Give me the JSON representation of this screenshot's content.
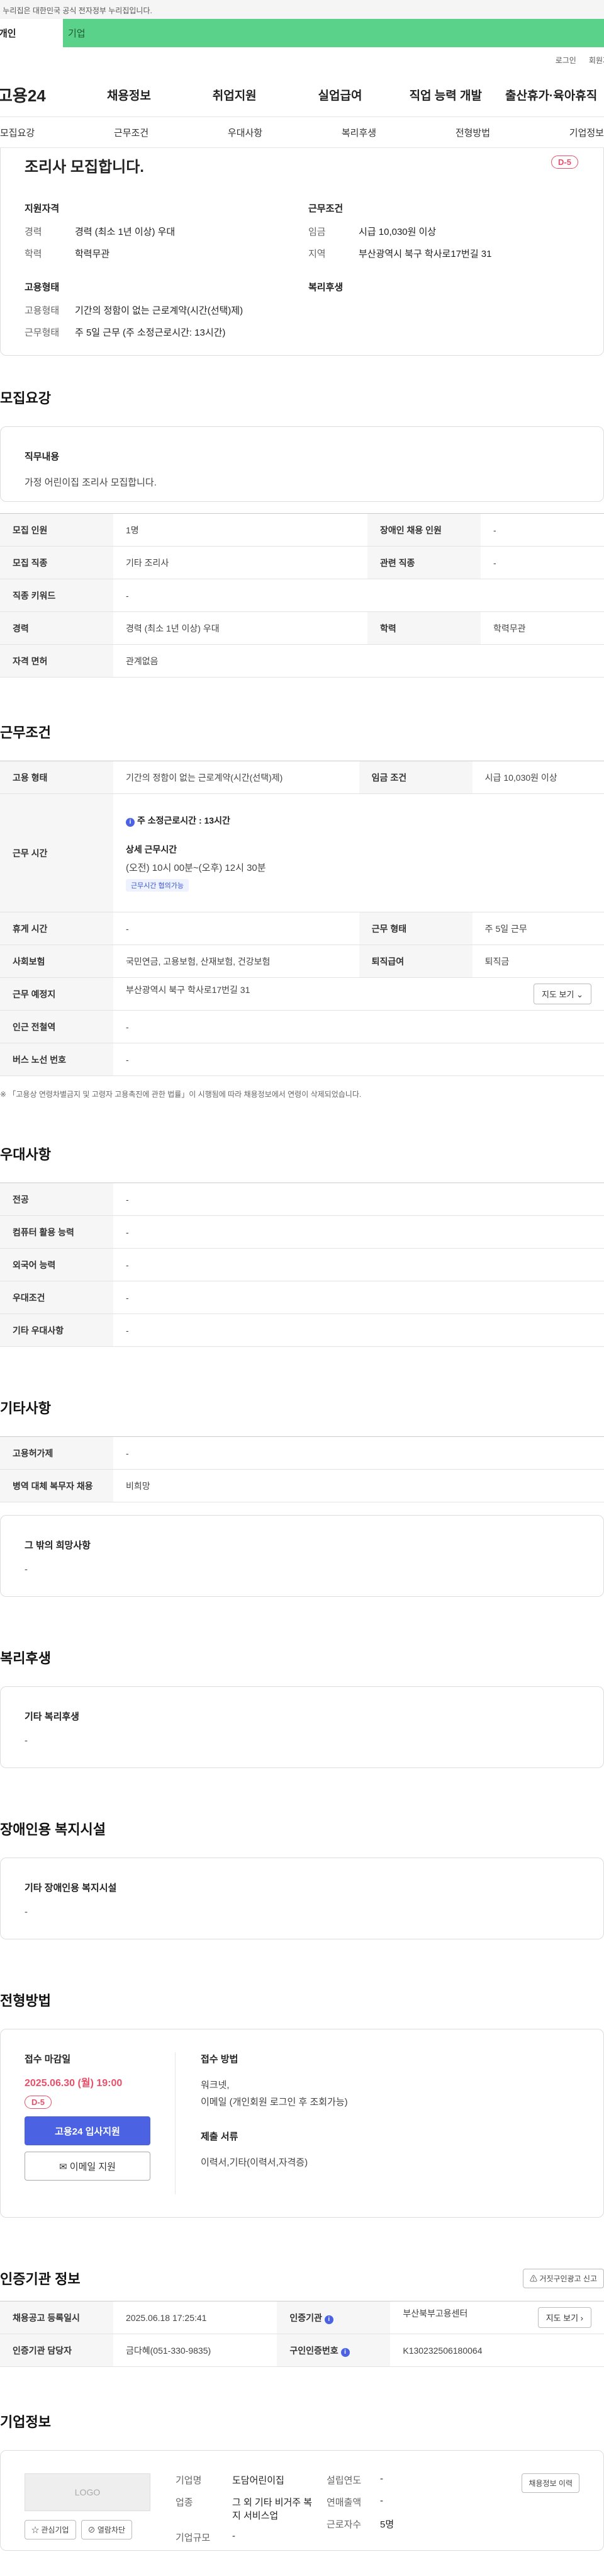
{
  "gov_notice": "이 누리집은 대한민국 공식 전자정부 누리집입니다.",
  "tabs": {
    "personal": "개인",
    "company": "기업"
  },
  "util": {
    "login": "로그인",
    "join": "회원가입"
  },
  "logo": "고용24",
  "mainnav": [
    "채용정보",
    "취업지원",
    "실업급여",
    "직업 능력 개발",
    "출산휴가·육아휴직"
  ],
  "subnav": [
    "모집요강",
    "근무조건",
    "우대사항",
    "복리후생",
    "전형방법",
    "기업정보"
  ],
  "summary": {
    "title": "조리사 모집합니다.",
    "dday": "D-5",
    "qual_title": "지원자격",
    "qual": [
      {
        "k": "경력",
        "v": "경력 (최소 1년 이상) 우대"
      },
      {
        "k": "학력",
        "v": "학력무관"
      }
    ],
    "work_title": "근무조건",
    "work": [
      {
        "k": "임금",
        "v": "시급 10,030원 이상"
      },
      {
        "k": "지역",
        "v": "부산광역시 북구 학사로17번길 31"
      }
    ],
    "emp_title": "고용형태",
    "emp": [
      {
        "k": "고용형태",
        "v": "기간의 정함이 없는 근로계약(시간(선택)제)"
      },
      {
        "k": "근무형태",
        "v": "주 5일 근무 (주 소정근로시간: 13시간)"
      }
    ],
    "welfare_title": "복리후생"
  },
  "recruit": {
    "heading": "모집요강",
    "duty_title": "직무내용",
    "duty_body": "가정 어린이집 조리사 모집합니다.",
    "rows": [
      {
        "k1": "모집 인원",
        "v1": "1명",
        "k2": "장애인 채용 인원",
        "v2": "-"
      },
      {
        "k1": "모집 직종",
        "v1": "기타 조리사",
        "k2": "관련 직종",
        "v2": "-"
      },
      {
        "k1": "직종 키워드",
        "v1": "-"
      },
      {
        "k1": "경력",
        "v1": "경력 (최소 1년 이상) 우대",
        "k2": "학력",
        "v2": "학력무관"
      },
      {
        "k1": "자격 면허",
        "v1": "관계없음"
      }
    ]
  },
  "work": {
    "heading": "근무조건",
    "emp_k": "고용 형태",
    "emp_v": "기간의 정함이 없는 근로계약(시간(선택)제)",
    "wage_k": "임금 조건",
    "wage_v": "시급 10,030원 이상",
    "hours_k": "근무 시간",
    "hours_main": "주 소정근로시간 : 13시간",
    "hours_detail_title": "상세 근무시간",
    "hours_detail": "(오전) 10시 00분~(오후) 12시 30분",
    "hours_badge": "근무시간 협의가능",
    "rest_k": "휴게 시간",
    "rest_v": "-",
    "wtype_k": "근무 형태",
    "wtype_v": "주 5일 근무",
    "ins_k": "사회보험",
    "ins_v": "국민연금, 고용보험, 산재보험, 건강보험",
    "sev_k": "퇴직급여",
    "sev_v": "퇴직금",
    "place_k": "근무 예정지",
    "place_v": "부산광역시 북구 학사로17번길 31",
    "map_btn": "지도 보기",
    "subway_k": "인근 전철역",
    "subway_v": "-",
    "bus_k": "버스 노선 번호",
    "bus_v": "-",
    "note": "※ 「고용상 연령차별금지 및 고령자 고용촉진에 관한 법률」이 시행됨에 따라 채용정보에서 연령이 삭제되었습니다."
  },
  "pref": {
    "heading": "우대사항",
    "rows": [
      {
        "k": "전공",
        "v": "-"
      },
      {
        "k": "컴퓨터 활용 능력",
        "v": "-"
      },
      {
        "k": "외국어 능력",
        "v": "-"
      },
      {
        "k": "우대조건",
        "v": "-"
      },
      {
        "k": "기타 우대사항",
        "v": "-"
      }
    ]
  },
  "etc": {
    "heading": "기타사항",
    "rows": [
      {
        "k": "고용허가제",
        "v": "-"
      },
      {
        "k": "병역 대체 복무자 채용",
        "v": "비희망"
      }
    ],
    "other_title": "그 밖의 희망사항",
    "other_body": "-"
  },
  "welfare": {
    "heading": "복리후생",
    "title": "기타 복리후생",
    "body": "-"
  },
  "disabled": {
    "heading": "장애인용 복지시설",
    "title": "기타 장애인용 복지시설",
    "body": "-"
  },
  "method": {
    "heading": "전형방법",
    "deadline_title": "접수 마감일",
    "deadline": "2025.06.30 (월) 19:00",
    "dday": "D-5",
    "apply_btn": "고용24 입사지원",
    "email_btn": "이메일 지원",
    "how_title": "접수 방법",
    "how_body1": "워크넷,",
    "how_body2": "이메일 (개인회원 로그인 후 조회가능)",
    "docs_title": "제출 서류",
    "docs_body": "이력서,기타(이력서,자격증)"
  },
  "cert": {
    "heading": "인증기관 정보",
    "report_btn": "거짓구인광고 신고",
    "rows": [
      {
        "k1": "채용공고 등록일시",
        "v1": "2025.06.18 17:25:41",
        "k2": "인증기관",
        "v2": "부산북부고용센터",
        "btn": "지도 보기"
      },
      {
        "k1": "인증기관 담당자",
        "v1": "금다혜(051-330-9835)",
        "k2": "구인인증번호",
        "v2": "K130232506180064"
      }
    ]
  },
  "company": {
    "heading": "기업정보",
    "logo": "LOGO",
    "fav_btn": "관심기업",
    "block_btn": "열람차단",
    "name_k": "기업명",
    "name_v": "도담어린이집",
    "ind_k": "업종",
    "ind_v": "그 외 기타 비거주 복지 서비스업",
    "size_k": "기업규모",
    "size_v": "-",
    "year_k": "설립연도",
    "year_v": "-",
    "sales_k": "연매출액",
    "sales_v": "-",
    "emp_k": "근로자수",
    "emp_v": "5명",
    "history_btn": "채용정보 이력"
  }
}
